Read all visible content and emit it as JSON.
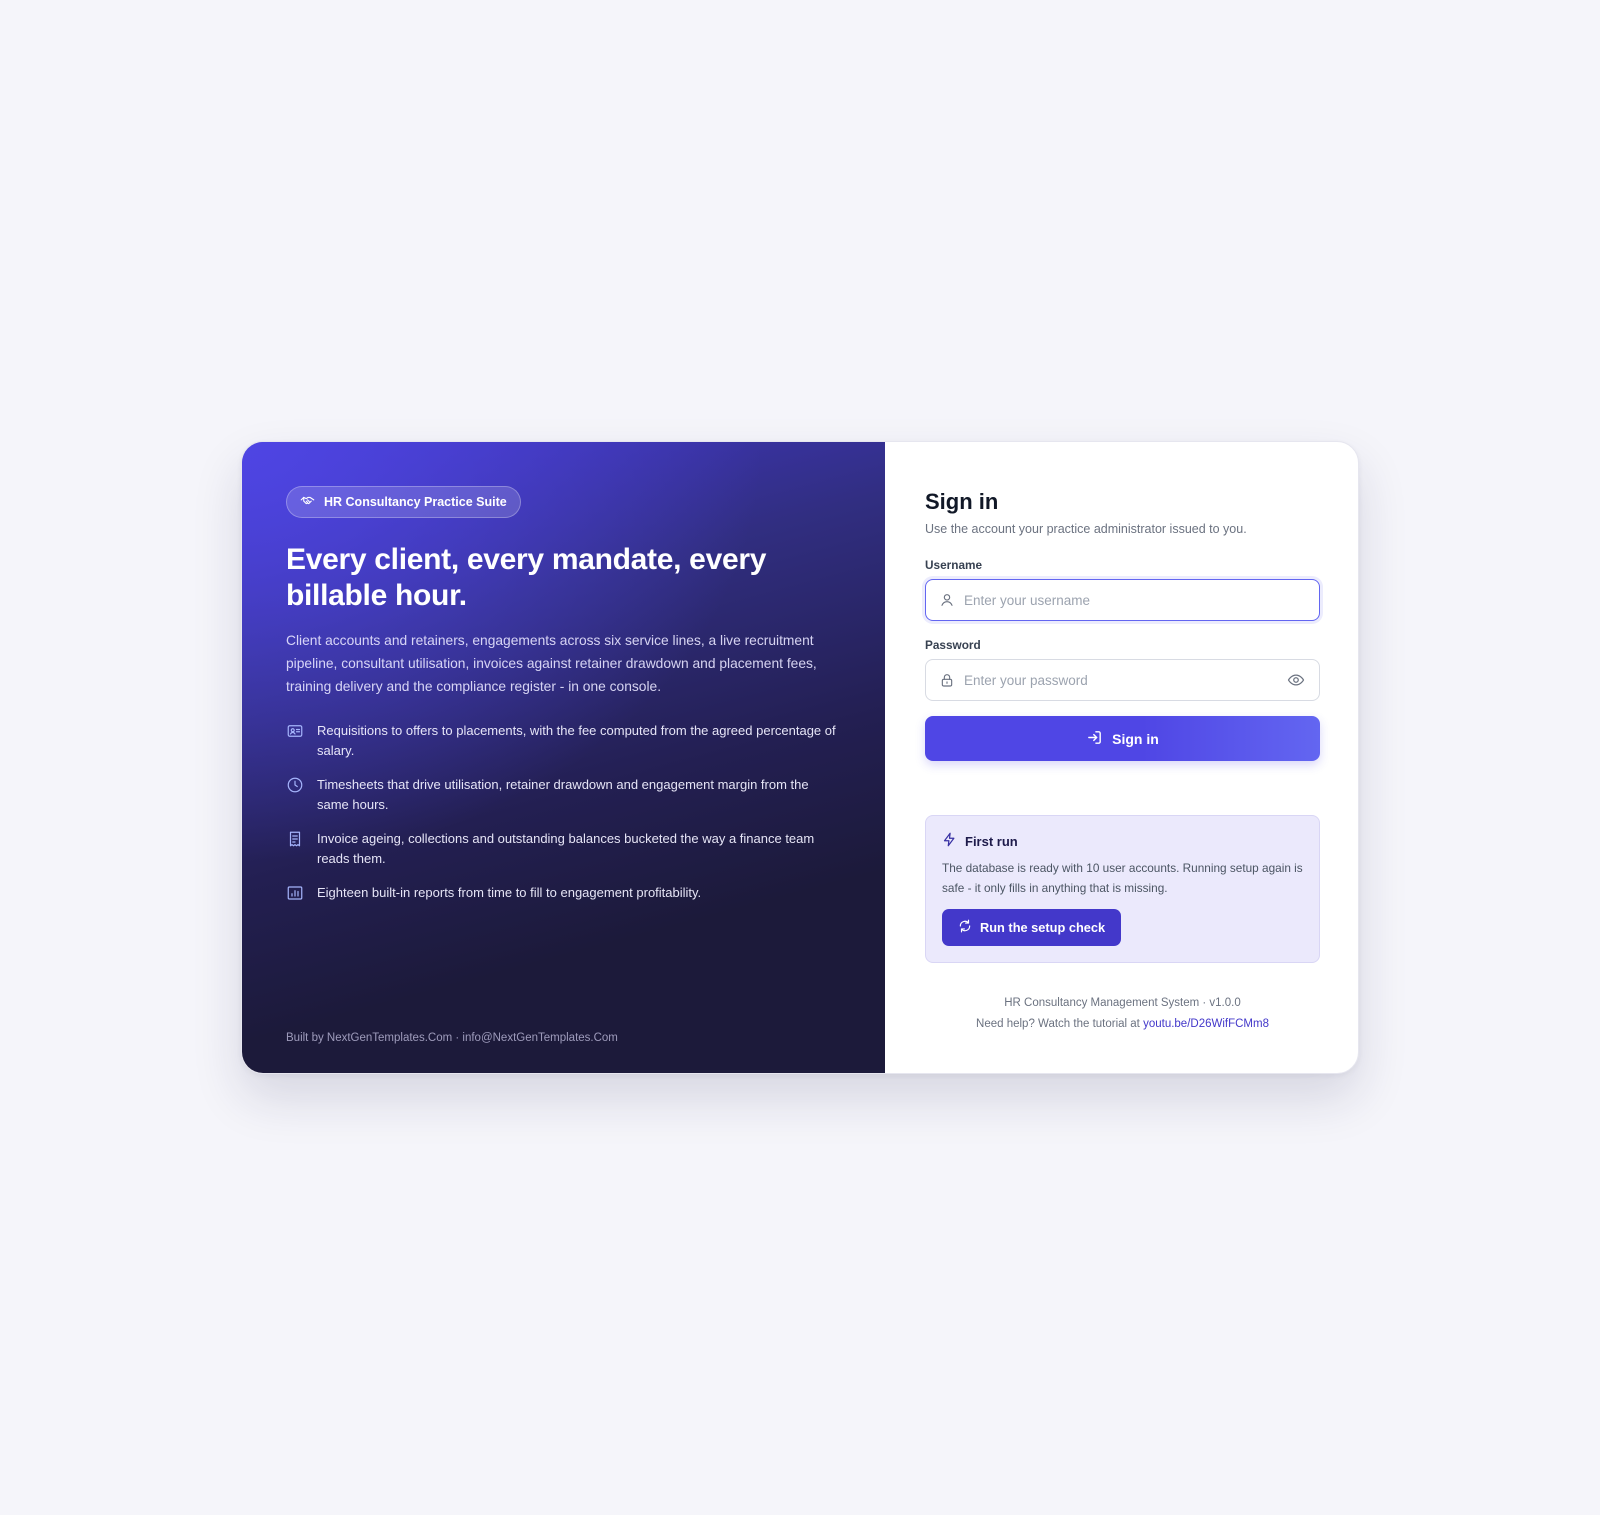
{
  "hero": {
    "badge": {
      "icon": "handshake-icon",
      "label": "HR Consultancy Practice Suite"
    },
    "title": "Every client, every mandate, every billable hour.",
    "description": "Client accounts and retainers, engagements across six service lines, a live recruitment pipeline, consultant utilisation, invoices against retainer drawdown and placement fees, training delivery and the compliance register - in one console.",
    "features": [
      {
        "icon": "id-card-icon",
        "text": "Requisitions to offers to placements, with the fee computed from the agreed percentage of salary."
      },
      {
        "icon": "clock-icon",
        "text": "Timesheets that drive utilisation, retainer drawdown and engagement margin from the same hours."
      },
      {
        "icon": "receipt-icon",
        "text": "Invoice ageing, collections and outstanding balances bucketed the way a finance team reads them."
      },
      {
        "icon": "bar-chart-icon",
        "text": "Eighteen built-in reports from time to fill to engagement profitability."
      }
    ],
    "footer": "Built by NextGenTemplates.Com · info@NextGenTemplates.Com"
  },
  "signin": {
    "title": "Sign in",
    "subtitle": "Use the account your practice administrator issued to you.",
    "username": {
      "label": "Username",
      "value": "",
      "placeholder": "Enter your username",
      "icon": "user-icon"
    },
    "password": {
      "label": "Password",
      "value": "",
      "placeholder": "Enter your password",
      "icon": "lock-icon",
      "toggle_icon": "eye-icon"
    },
    "submit_label": "Sign in",
    "submit_icon": "sign-in-icon"
  },
  "first_run": {
    "icon": "lightning-icon",
    "title": "First run",
    "text": "The database is ready with 10 user accounts. Running setup again is safe - it only fills in anything that is missing.",
    "button_label": "Run the setup check",
    "button_icon": "refresh-icon"
  },
  "meta": {
    "version_line": "HR Consultancy Management System · v1.0.0",
    "help_prefix": "Need help? Watch the tutorial at ",
    "help_link": "youtu.be/D26WifFCMm8"
  },
  "colors": {
    "accent": "#4f46e5",
    "hero_dark": "#1c1a3a",
    "page_bg": "#f5f5fa"
  }
}
